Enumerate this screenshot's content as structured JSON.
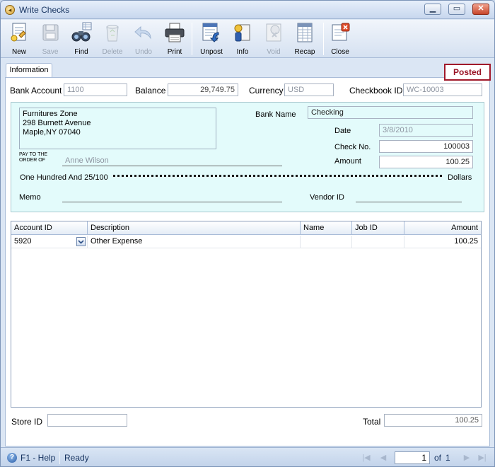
{
  "window": {
    "title": "Write Checks"
  },
  "toolbar": {
    "new": "New",
    "save": "Save",
    "find": "Find",
    "delete": "Delete",
    "undo": "Undo",
    "print": "Print",
    "unpost": "Unpost",
    "info": "Info",
    "void": "Void",
    "recap": "Recap",
    "close": "Close"
  },
  "tab": {
    "label": "Information"
  },
  "status": {
    "label": "Posted",
    "color": "#a0182a"
  },
  "header": {
    "bank_account_label": "Bank Account",
    "bank_account": "1100",
    "balance_label": "Balance",
    "balance": "29,749.75",
    "currency_label": "Currency",
    "currency": "USD",
    "checkbook_label": "Checkbook ID",
    "checkbook": "WC-10003"
  },
  "check": {
    "payee_lines": [
      "Furnitures Zone",
      "298 Burnett Avenue",
      "Maple,NY 07040"
    ],
    "bank_name_label": "Bank Name",
    "bank_name": "Checking",
    "date_label": "Date",
    "date": "3/8/2010",
    "check_no_label": "Check No.",
    "check_no": "100003",
    "amount_label": "Amount",
    "amount": "100.25",
    "pay_to_line1": "PAY TO THE",
    "pay_to_line2": "ORDER OF",
    "pay_to_name": "Anne Wilson",
    "amount_words": "One Hundred  And 25/100",
    "dollars_label": "Dollars",
    "memo_label": "Memo",
    "vendor_label": "Vendor ID"
  },
  "grid": {
    "columns": [
      "Account ID",
      "Description",
      "Name",
      "Job ID",
      "Amount"
    ],
    "rows": [
      {
        "account": "5920",
        "description": "Other Expense",
        "name": "",
        "job": "",
        "amount": "100.25"
      }
    ]
  },
  "footer": {
    "store_label": "Store ID",
    "total_label": "Total",
    "total": "100.25"
  },
  "statusbar": {
    "help": "F1 - Help",
    "state": "Ready",
    "page": "1",
    "of_label": "of",
    "pages": "1"
  }
}
